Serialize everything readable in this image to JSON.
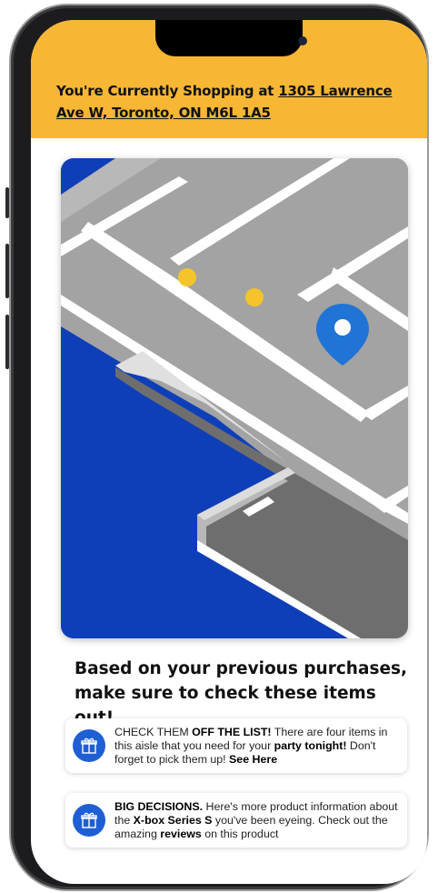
{
  "banner": {
    "prefix": "You're Currently Shopping at ",
    "address": "1305 Lawrence Ave W, Toronto, ON M6L 1A5",
    "color": "#f7b634"
  },
  "map": {
    "pin_icon": "location-pin-icon",
    "marker_icon": "aisle-marker-icon",
    "water_color": "#0f3fb8"
  },
  "recommendations": {
    "line1": "Based on your previous purchases,",
    "line2": "make sure to check these items out!"
  },
  "cards": [
    {
      "icon": "gift-icon",
      "p1": "CHECK THEM ",
      "b1": "OFF THE LIST!",
      "p2": " There are four items in this aisle that you need for your ",
      "b2": "party tonight!",
      "p3": " Don't forget to pick them up! ",
      "b3": "See Here"
    },
    {
      "icon": "gift-icon",
      "b1": "BIG DECISIONS.",
      "p1": " Here's more product information about the ",
      "b2": "X-box Series S",
      "p2": " you've been eyeing. Check out the amazing ",
      "b3": "reviews",
      "p3": " on this product"
    }
  ]
}
